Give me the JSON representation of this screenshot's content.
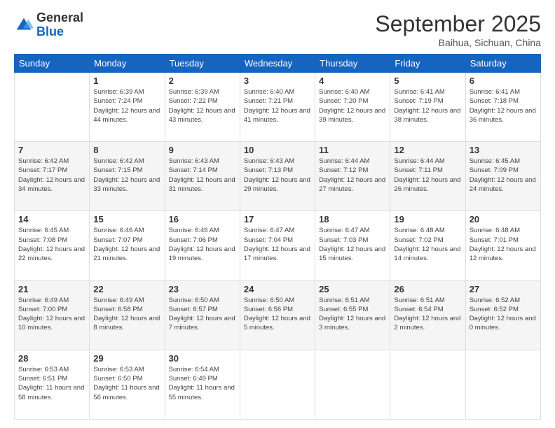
{
  "header": {
    "logo_general": "General",
    "logo_blue": "Blue",
    "month_title": "September 2025",
    "subtitle": "Baihua, Sichuan, China"
  },
  "days_of_week": [
    "Sunday",
    "Monday",
    "Tuesday",
    "Wednesday",
    "Thursday",
    "Friday",
    "Saturday"
  ],
  "weeks": [
    [
      {
        "day": "",
        "sunrise": "",
        "sunset": "",
        "daylight": ""
      },
      {
        "day": "1",
        "sunrise": "Sunrise: 6:39 AM",
        "sunset": "Sunset: 7:24 PM",
        "daylight": "Daylight: 12 hours and 44 minutes."
      },
      {
        "day": "2",
        "sunrise": "Sunrise: 6:39 AM",
        "sunset": "Sunset: 7:22 PM",
        "daylight": "Daylight: 12 hours and 43 minutes."
      },
      {
        "day": "3",
        "sunrise": "Sunrise: 6:40 AM",
        "sunset": "Sunset: 7:21 PM",
        "daylight": "Daylight: 12 hours and 41 minutes."
      },
      {
        "day": "4",
        "sunrise": "Sunrise: 6:40 AM",
        "sunset": "Sunset: 7:20 PM",
        "daylight": "Daylight: 12 hours and 39 minutes."
      },
      {
        "day": "5",
        "sunrise": "Sunrise: 6:41 AM",
        "sunset": "Sunset: 7:19 PM",
        "daylight": "Daylight: 12 hours and 38 minutes."
      },
      {
        "day": "6",
        "sunrise": "Sunrise: 6:41 AM",
        "sunset": "Sunset: 7:18 PM",
        "daylight": "Daylight: 12 hours and 36 minutes."
      }
    ],
    [
      {
        "day": "7",
        "sunrise": "Sunrise: 6:42 AM",
        "sunset": "Sunset: 7:17 PM",
        "daylight": "Daylight: 12 hours and 34 minutes."
      },
      {
        "day": "8",
        "sunrise": "Sunrise: 6:42 AM",
        "sunset": "Sunset: 7:15 PM",
        "daylight": "Daylight: 12 hours and 33 minutes."
      },
      {
        "day": "9",
        "sunrise": "Sunrise: 6:43 AM",
        "sunset": "Sunset: 7:14 PM",
        "daylight": "Daylight: 12 hours and 31 minutes."
      },
      {
        "day": "10",
        "sunrise": "Sunrise: 6:43 AM",
        "sunset": "Sunset: 7:13 PM",
        "daylight": "Daylight: 12 hours and 29 minutes."
      },
      {
        "day": "11",
        "sunrise": "Sunrise: 6:44 AM",
        "sunset": "Sunset: 7:12 PM",
        "daylight": "Daylight: 12 hours and 27 minutes."
      },
      {
        "day": "12",
        "sunrise": "Sunrise: 6:44 AM",
        "sunset": "Sunset: 7:11 PM",
        "daylight": "Daylight: 12 hours and 26 minutes."
      },
      {
        "day": "13",
        "sunrise": "Sunrise: 6:45 AM",
        "sunset": "Sunset: 7:09 PM",
        "daylight": "Daylight: 12 hours and 24 minutes."
      }
    ],
    [
      {
        "day": "14",
        "sunrise": "Sunrise: 6:45 AM",
        "sunset": "Sunset: 7:08 PM",
        "daylight": "Daylight: 12 hours and 22 minutes."
      },
      {
        "day": "15",
        "sunrise": "Sunrise: 6:46 AM",
        "sunset": "Sunset: 7:07 PM",
        "daylight": "Daylight: 12 hours and 21 minutes."
      },
      {
        "day": "16",
        "sunrise": "Sunrise: 6:46 AM",
        "sunset": "Sunset: 7:06 PM",
        "daylight": "Daylight: 12 hours and 19 minutes."
      },
      {
        "day": "17",
        "sunrise": "Sunrise: 6:47 AM",
        "sunset": "Sunset: 7:04 PM",
        "daylight": "Daylight: 12 hours and 17 minutes."
      },
      {
        "day": "18",
        "sunrise": "Sunrise: 6:47 AM",
        "sunset": "Sunset: 7:03 PM",
        "daylight": "Daylight: 12 hours and 15 minutes."
      },
      {
        "day": "19",
        "sunrise": "Sunrise: 6:48 AM",
        "sunset": "Sunset: 7:02 PM",
        "daylight": "Daylight: 12 hours and 14 minutes."
      },
      {
        "day": "20",
        "sunrise": "Sunrise: 6:48 AM",
        "sunset": "Sunset: 7:01 PM",
        "daylight": "Daylight: 12 hours and 12 minutes."
      }
    ],
    [
      {
        "day": "21",
        "sunrise": "Sunrise: 6:49 AM",
        "sunset": "Sunset: 7:00 PM",
        "daylight": "Daylight: 12 hours and 10 minutes."
      },
      {
        "day": "22",
        "sunrise": "Sunrise: 6:49 AM",
        "sunset": "Sunset: 6:58 PM",
        "daylight": "Daylight: 12 hours and 8 minutes."
      },
      {
        "day": "23",
        "sunrise": "Sunrise: 6:50 AM",
        "sunset": "Sunset: 6:57 PM",
        "daylight": "Daylight: 12 hours and 7 minutes."
      },
      {
        "day": "24",
        "sunrise": "Sunrise: 6:50 AM",
        "sunset": "Sunset: 6:56 PM",
        "daylight": "Daylight: 12 hours and 5 minutes."
      },
      {
        "day": "25",
        "sunrise": "Sunrise: 6:51 AM",
        "sunset": "Sunset: 6:55 PM",
        "daylight": "Daylight: 12 hours and 3 minutes."
      },
      {
        "day": "26",
        "sunrise": "Sunrise: 6:51 AM",
        "sunset": "Sunset: 6:54 PM",
        "daylight": "Daylight: 12 hours and 2 minutes."
      },
      {
        "day": "27",
        "sunrise": "Sunrise: 6:52 AM",
        "sunset": "Sunset: 6:52 PM",
        "daylight": "Daylight: 12 hours and 0 minutes."
      }
    ],
    [
      {
        "day": "28",
        "sunrise": "Sunrise: 6:53 AM",
        "sunset": "Sunset: 6:51 PM",
        "daylight": "Daylight: 11 hours and 58 minutes."
      },
      {
        "day": "29",
        "sunrise": "Sunrise: 6:53 AM",
        "sunset": "Sunset: 6:50 PM",
        "daylight": "Daylight: 11 hours and 56 minutes."
      },
      {
        "day": "30",
        "sunrise": "Sunrise: 6:54 AM",
        "sunset": "Sunset: 6:49 PM",
        "daylight": "Daylight: 11 hours and 55 minutes."
      },
      {
        "day": "",
        "sunrise": "",
        "sunset": "",
        "daylight": ""
      },
      {
        "day": "",
        "sunrise": "",
        "sunset": "",
        "daylight": ""
      },
      {
        "day": "",
        "sunrise": "",
        "sunset": "",
        "daylight": ""
      },
      {
        "day": "",
        "sunrise": "",
        "sunset": "",
        "daylight": ""
      }
    ]
  ]
}
